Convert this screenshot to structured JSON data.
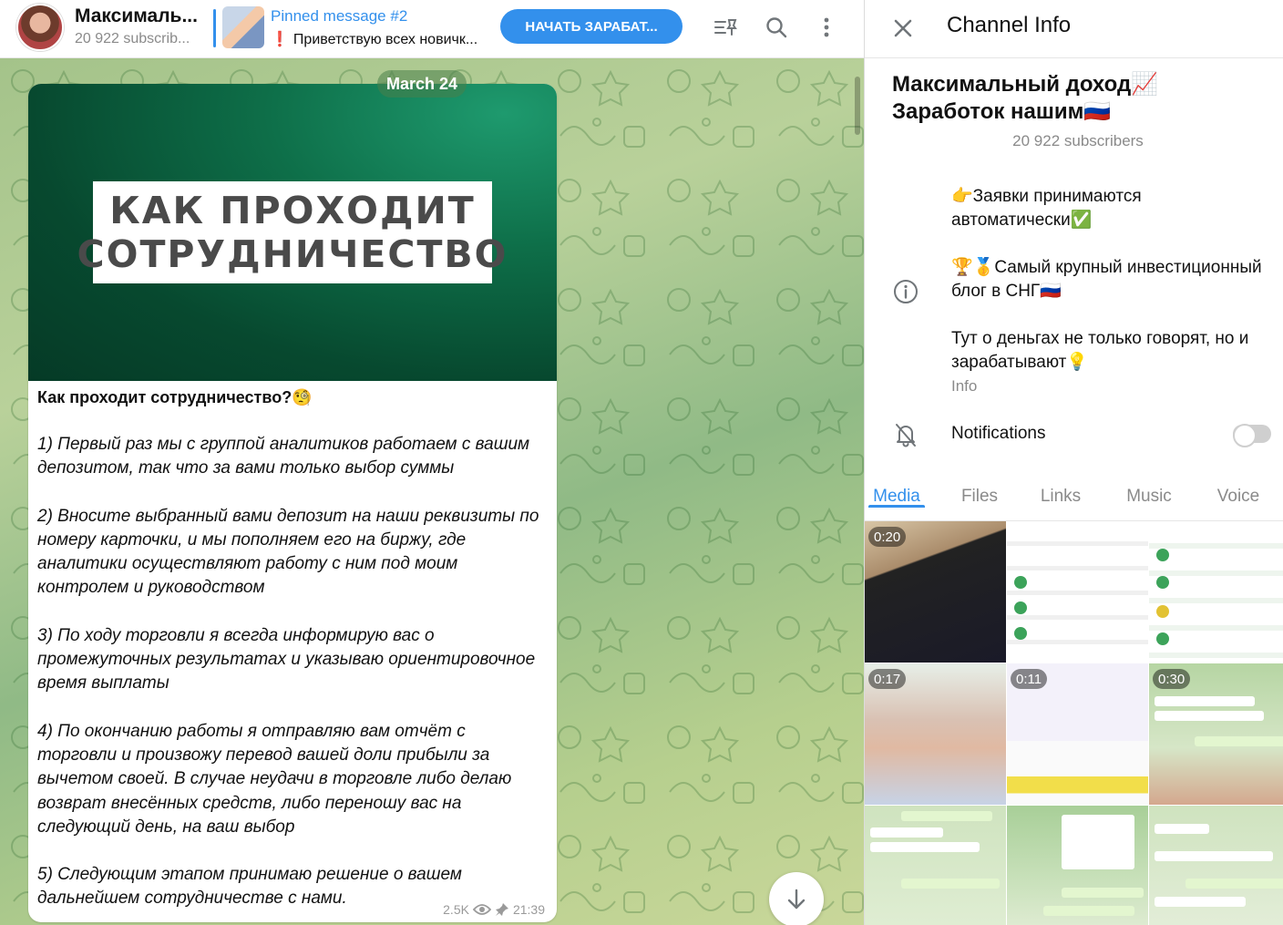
{
  "header": {
    "channel_title": "Максимальный доход📈 Заработок нашим🇷🇺",
    "channel_title_short": "Максималь...",
    "subscribers_short": "20 922 subscrib...",
    "pinned_title": "Pinned message #2",
    "pinned_text": "Приветствую всех новичк...",
    "pinned_mark": "❗",
    "cta_label": "НАЧАТЬ ЗАРАБАТ..."
  },
  "chat": {
    "date": "March 24",
    "image_text": [
      "КАК ПРОХОДИТ",
      "СОТРУДНИЧЕСТВО"
    ],
    "heading": "Как проходит сотрудничество?🧐",
    "paragraphs": [
      "1) Первый раз мы с группой аналитиков работаем с вашим депозитом, так что за вами только выбор суммы",
      "2) Вносите выбранный вами депозит на наши реквизиты по номеру карточки, и мы пополняем его на биржу, где аналитики осуществляют работу с ним под моим контролем и руководством",
      "3) По ходу торговли я всегда информирую вас о промежуточных результатах и указываю ориентировочное время выплаты",
      "4) По окончанию работы я отправляю вам отчёт с торговли и произвожу перевод вашей доли прибыли за вычетом своей. В случае неудачи в торговле либо делаю возврат внесённых средств, либо переношу вас на следующий день, на ваш выбор",
      "5) Следующим этапом принимаю решение о вашем дальнейшем сотрудничестве с нами."
    ],
    "views": "2.5K",
    "time": "21:39"
  },
  "panel": {
    "title": "Channel Info",
    "name_line1": "Максимальный доход📈",
    "name_line2": "Заработок нашим🇷🇺",
    "subscribers": "20 922 subscribers",
    "description": [
      "👉Заявки принимаются автоматически✅",
      "🏆🥇Самый крупный инвестиционный блог в СНГ🇷🇺",
      "Тут о деньгах не только говорят, но и зарабатывают💡"
    ],
    "info_label": "Info",
    "notifications_label": "Notifications",
    "notifications_on": false,
    "tabs": [
      "Media",
      "Files",
      "Links",
      "Music",
      "Voice"
    ],
    "active_tab": "Media",
    "media_durations": [
      "0:20",
      "0:17",
      "0:11",
      "0:30"
    ]
  },
  "colors": {
    "accent": "#3390ec",
    "chat_bg": "#a4c38a",
    "muted": "#8a8a8a"
  }
}
